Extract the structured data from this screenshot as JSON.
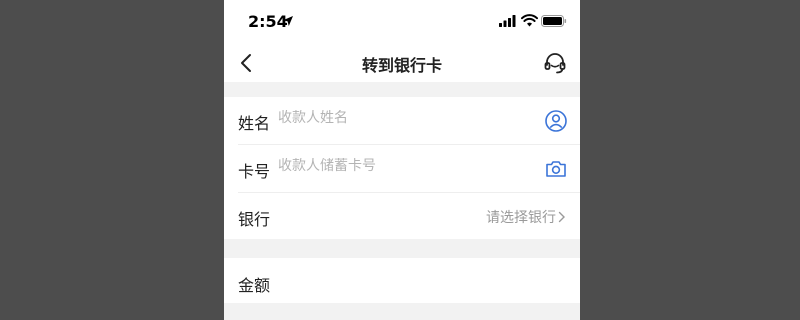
{
  "status_bar": {
    "time": "2:54",
    "icons": [
      "location-arrow-icon",
      "signal-icon",
      "wifi-icon",
      "battery-icon"
    ]
  },
  "nav": {
    "title": "转到银行卡",
    "back_icon": "chevron-left-icon",
    "service_icon": "headset-icon"
  },
  "form": {
    "name": {
      "label": "姓名",
      "placeholder": "收款人姓名",
      "value": "",
      "icon": "contact-icon"
    },
    "card": {
      "label": "卡号",
      "placeholder": "收款人储蓄卡号",
      "value": "",
      "icon": "camera-icon"
    },
    "bank": {
      "label": "银行",
      "select_text": "请选择银行"
    }
  },
  "amount": {
    "label": "金额"
  },
  "colors": {
    "accent": "#3b74d8",
    "background": "#f2f2f2",
    "placeholder": "#b4b4b4"
  }
}
